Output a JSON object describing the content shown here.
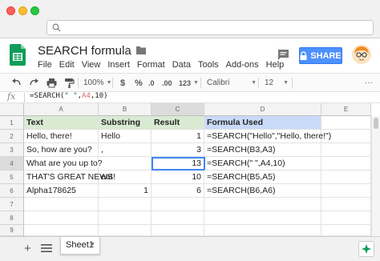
{
  "doc": {
    "title": "SEARCH formula",
    "share_label": "SHARE"
  },
  "menu": [
    "File",
    "Edit",
    "View",
    "Insert",
    "Format",
    "Data",
    "Tools",
    "Add-ons",
    "Help"
  ],
  "toolbar": {
    "zoom": "100%",
    "currency": "$",
    "percent": "%",
    "dec_less": ".0",
    "dec_more": ".00",
    "number_format": "123",
    "font": "Calibri",
    "font_size": "12"
  },
  "formula_bar": {
    "fx": "fx",
    "prefix": "=SEARCH(",
    "string_arg": "\" \"",
    "comma": ",",
    "ref": "A4",
    "suffix": ",10)"
  },
  "columns": [
    "A",
    "B",
    "C",
    "D",
    "E"
  ],
  "active_column": "C",
  "rows": [
    "1",
    "2",
    "3",
    "4",
    "5",
    "6",
    "7",
    "8",
    "9"
  ],
  "active_row": "4",
  "table": {
    "headers": [
      "Text",
      "Substring",
      "Result",
      "Formula Used"
    ],
    "data": [
      [
        "Hello, there!",
        "Hello",
        "1",
        "=SEARCH(\"Hello\",\"Hello, there!\")"
      ],
      [
        "So, how are you?",
        ",",
        "3",
        "=SEARCH(B3,A3)"
      ],
      [
        "What are you up to?",
        "",
        "13",
        "=SEARCH(\" \",A4,10)"
      ],
      [
        "THAT'S GREAT NEWS!",
        "eat",
        "10",
        "=SEARCH(B5,A5)"
      ],
      [
        "Alpha178625",
        "1",
        "6",
        "=SEARCH(B6,A6)"
      ]
    ]
  },
  "sheets": {
    "add_label": "+",
    "tabs": [
      "Sheet1"
    ]
  },
  "colors": {
    "header_green": "#d9ead3",
    "header_blue": "#c9daf8",
    "selection": "#4285f4",
    "share": "#4d90fe"
  }
}
